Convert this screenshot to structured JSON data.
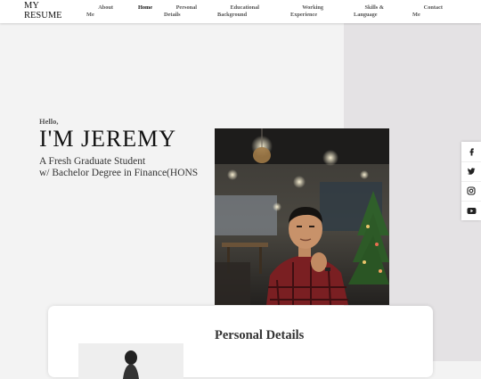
{
  "brand": {
    "line1": "MY",
    "line2": "RESUME"
  },
  "nav": [
    {
      "line1": "About",
      "line2": "Me"
    },
    {
      "line1": "Home",
      "line2": ""
    },
    {
      "line1": "Personal",
      "line2": "Details"
    },
    {
      "line1": "Educational",
      "line2": "Background"
    },
    {
      "line1": "Working",
      "line2": "Experience"
    },
    {
      "line1": "Skills &",
      "line2": "Language"
    },
    {
      "line1": "Contact",
      "line2": "Me"
    }
  ],
  "hero": {
    "greeting": "Hello,",
    "name": "I'M JEREMY",
    "subtitle_line1": "A Fresh Graduate Student",
    "subtitle_line2": "w/ Bachelor Degree in Finance(HONS"
  },
  "social": [
    "facebook-icon",
    "twitter-icon",
    "instagram-icon",
    "youtube-icon"
  ],
  "section": {
    "title": "Personal Details"
  },
  "colors": {
    "hero_right_panel": "#e4e2e4",
    "page_bg": "#f3f3f3"
  }
}
